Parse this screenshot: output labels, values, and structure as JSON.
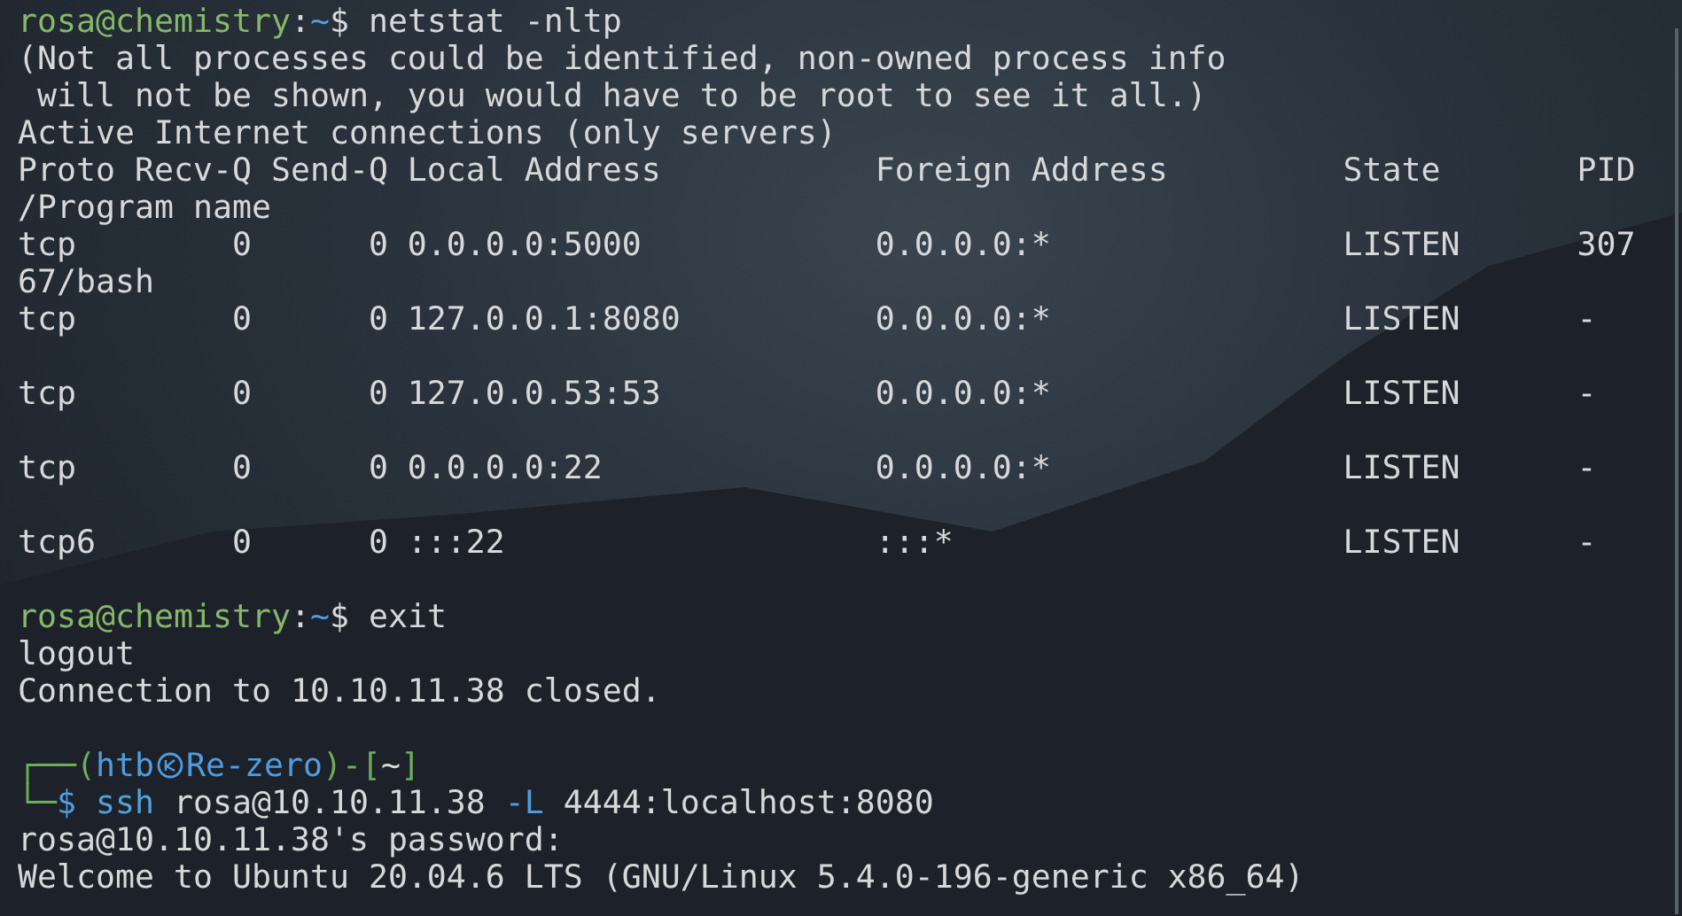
{
  "terminal": {
    "lines": [
      {
        "kind": "prompt",
        "segments": [
          {
            "kind": "user-host",
            "text": "rosa@chemistry"
          },
          {
            "kind": "colon",
            "text": ":"
          },
          {
            "kind": "path",
            "text": "~"
          },
          {
            "kind": "dollar",
            "text": "$"
          },
          {
            "kind": "command",
            "text": "netstat -nltp"
          }
        ]
      },
      {
        "kind": "output",
        "text": "(Not all processes could be identified, non-owned process info"
      },
      {
        "kind": "output",
        "text": " will not be shown, you would have to be root to see it all.)"
      },
      {
        "kind": "output",
        "text": "Active Internet connections (only servers)"
      },
      {
        "kind": "output",
        "text": "Proto Recv-Q Send-Q Local Address           Foreign Address         State       PID"
      },
      {
        "kind": "output",
        "text": "/Program name"
      },
      {
        "kind": "output",
        "text": "tcp        0      0 0.0.0.0:5000            0.0.0.0:*               LISTEN      307"
      },
      {
        "kind": "output",
        "text": "67/bash"
      },
      {
        "kind": "output",
        "text": "tcp        0      0 127.0.0.1:8080          0.0.0.0:*               LISTEN      -"
      },
      {
        "kind": "blank"
      },
      {
        "kind": "output",
        "text": "tcp        0      0 127.0.0.53:53           0.0.0.0:*               LISTEN      -"
      },
      {
        "kind": "blank"
      },
      {
        "kind": "output",
        "text": "tcp        0      0 0.0.0.0:22              0.0.0.0:*               LISTEN      -"
      },
      {
        "kind": "blank"
      },
      {
        "kind": "output",
        "text": "tcp6       0      0 :::22                   :::*                    LISTEN      -"
      },
      {
        "kind": "blank"
      },
      {
        "kind": "prompt",
        "segments": [
          {
            "kind": "user-host",
            "text": "rosa@chemistry"
          },
          {
            "kind": "colon",
            "text": ":"
          },
          {
            "kind": "path",
            "text": "~"
          },
          {
            "kind": "dollar",
            "text": "$"
          },
          {
            "kind": "command",
            "text": "exit"
          }
        ]
      },
      {
        "kind": "output",
        "text": "logout"
      },
      {
        "kind": "output",
        "text": "Connection to 10.10.11.38 closed."
      },
      {
        "kind": "blank"
      },
      {
        "kind": "prompt",
        "segments": [
          {
            "kind": "frame",
            "text": "┌──("
          },
          {
            "kind": "user",
            "text": "htb"
          },
          {
            "kind": "icon"
          },
          {
            "kind": "host",
            "text": "Re-zero"
          },
          {
            "kind": "frame",
            "text": ")-["
          },
          {
            "kind": "cwd",
            "text": "~"
          },
          {
            "kind": "frame",
            "text": "]"
          }
        ]
      },
      {
        "kind": "prompt",
        "segments": [
          {
            "kind": "frame",
            "text": "└─"
          },
          {
            "kind": "shell-symbol",
            "text": "$"
          },
          {
            "kind": "program",
            "text": "ssh"
          },
          {
            "kind": "arg",
            "text": "rosa@10.10.11.38"
          },
          {
            "kind": "flag",
            "text": "-L"
          },
          {
            "kind": "arg",
            "text": "4444:localhost:8080"
          }
        ]
      },
      {
        "kind": "output",
        "text": "rosa@10.10.11.38's password:"
      },
      {
        "kind": "output",
        "text": "Welcome to Ubuntu 20.04.6 LTS (GNU/Linux 5.4.0-196-generic x86_64)"
      }
    ]
  }
}
